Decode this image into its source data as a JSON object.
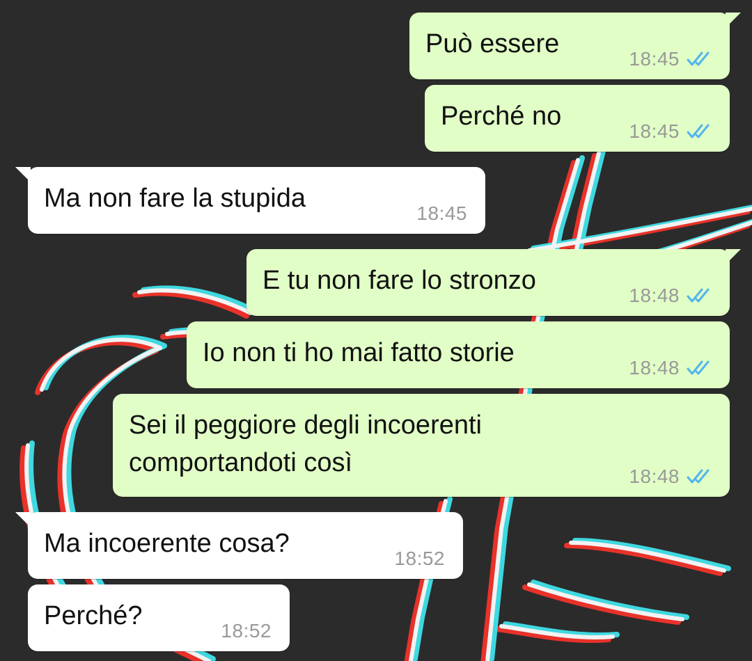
{
  "colors": {
    "outgoing_bubble": "#e1fec6",
    "incoming_bubble": "#ffffff",
    "background": "#2b2b2b",
    "read_tick": "#4fb6ec",
    "time": "#999999"
  },
  "messages": [
    {
      "direction": "outgoing",
      "text": "Può essere",
      "time": "18:45",
      "status_icon": "double-check-read-icon"
    },
    {
      "direction": "outgoing",
      "text": "Perché no",
      "time": "18:45",
      "status_icon": "double-check-read-icon"
    },
    {
      "direction": "incoming",
      "text": "Ma non fare la stupida",
      "time": "18:45"
    },
    {
      "direction": "outgoing",
      "text": "E tu non fare lo stronzo",
      "time": "18:48",
      "status_icon": "double-check-read-icon"
    },
    {
      "direction": "outgoing",
      "text": "Io non ti ho mai fatto storie",
      "time": "18:48",
      "status_icon": "double-check-read-icon"
    },
    {
      "direction": "outgoing",
      "text": "Sei il peggiore degli incoerenti\ncomportandoti così",
      "time": "18:48",
      "status_icon": "double-check-read-icon"
    },
    {
      "direction": "incoming",
      "text": "Ma incoerente cosa?",
      "time": "18:52"
    },
    {
      "direction": "incoming",
      "text": "Perché?",
      "time": "18:52"
    }
  ]
}
